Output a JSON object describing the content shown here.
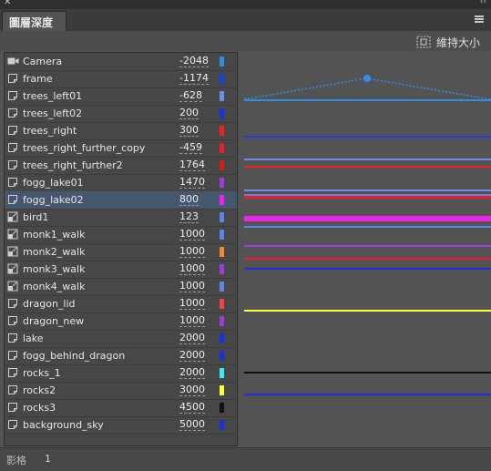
{
  "panel": {
    "close_glyph": "✕",
    "collapse_glyph": "‹‹",
    "tab_label": "圖層深度",
    "menu_icon": "hamburger-menu-icon",
    "resize_label": "維持大小"
  },
  "layers": [
    {
      "name": "Camera",
      "depth": "-2048",
      "type": "camera",
      "color": "#2e8fe8",
      "selected": false
    },
    {
      "name": "frame",
      "depth": "-1174",
      "type": "layer",
      "color": "#1a3ee0",
      "selected": false
    },
    {
      "name": "trees_left01",
      "depth": "-628",
      "type": "layer",
      "color": "#6a8fe8",
      "selected": false
    },
    {
      "name": "trees_left02",
      "depth": "200",
      "type": "layer",
      "color": "#1a2fe0",
      "selected": false
    },
    {
      "name": "trees_right",
      "depth": "300",
      "type": "layer",
      "color": "#ee2222",
      "selected": false
    },
    {
      "name": "trees_right_further_copy",
      "depth": "-459",
      "type": "layer",
      "color": "#ee1b2c",
      "selected": false
    },
    {
      "name": "trees_right_further2",
      "depth": "1764",
      "type": "layer",
      "color": "#dd1a1a",
      "selected": false
    },
    {
      "name": "fogg_lake01",
      "depth": "1470",
      "type": "layer",
      "color": "#9a3fd6",
      "selected": false
    },
    {
      "name": "fogg_lake02",
      "depth": "800",
      "type": "layer",
      "color": "#ee22ee",
      "selected": true
    },
    {
      "name": "bird1",
      "depth": "123",
      "type": "symbol",
      "color": "#5a86e6",
      "selected": false
    },
    {
      "name": "monk1_walk",
      "depth": "1000",
      "type": "symbol",
      "color": "#5a86e6",
      "selected": false
    },
    {
      "name": "monk2_walk",
      "depth": "1000",
      "type": "symbol",
      "color": "#ee8833",
      "selected": false
    },
    {
      "name": "monk3_walk",
      "depth": "1000",
      "type": "symbol",
      "color": "#9a3fd6",
      "selected": false
    },
    {
      "name": "monk4_walk",
      "depth": "1000",
      "type": "symbol",
      "color": "#5a86e6",
      "selected": false
    },
    {
      "name": "dragon_lid",
      "depth": "1000",
      "type": "layer",
      "color": "#ee4444",
      "selected": false
    },
    {
      "name": "dragon_new",
      "depth": "1000",
      "type": "layer",
      "color": "#9a3fd6",
      "selected": false
    },
    {
      "name": "lake",
      "depth": "2000",
      "type": "layer",
      "color": "#1a2fe0",
      "selected": false
    },
    {
      "name": "fogg_behind_dragon",
      "depth": "2000",
      "type": "layer",
      "color": "#1a2fe0",
      "selected": false
    },
    {
      "name": "rocks_1",
      "depth": "2000",
      "type": "layer",
      "color": "#33eeee",
      "selected": false
    },
    {
      "name": "rocks2",
      "depth": "3000",
      "type": "layer",
      "color": "#ffff33",
      "selected": false
    },
    {
      "name": "rocks3",
      "depth": "4500",
      "type": "layer",
      "color": "#111111",
      "selected": false
    },
    {
      "name": "background_sky",
      "depth": "5000",
      "type": "layer",
      "color": "#1a2fe0",
      "selected": false
    }
  ],
  "timeline_lines": [
    {
      "depth_label": "frame",
      "color": "#1a3ee0"
    },
    {
      "depth_label": "trees_left01",
      "color": "#6a8fe8"
    },
    {
      "depth_label": "trees_right",
      "color": "#ee2222"
    },
    {
      "depth_label": "bird1",
      "color": "#5a86e6"
    },
    {
      "depth_label": "fogg_lake02",
      "color": "#ee22ee"
    },
    {
      "depth_label": "monk2_walk",
      "color": "#9a3fd6"
    },
    {
      "depth_label": "trees_right_further2",
      "color": "#ee1b2c"
    },
    {
      "depth_label": "lake",
      "color": "#1a2fe0"
    },
    {
      "depth_label": "rocks2",
      "color": "#ffff33"
    },
    {
      "depth_label": "rocks3",
      "color": "#111111"
    },
    {
      "depth_label": "background_sky",
      "color": "#1a2fe0"
    }
  ],
  "footer": {
    "label": "影格",
    "value": "1"
  }
}
